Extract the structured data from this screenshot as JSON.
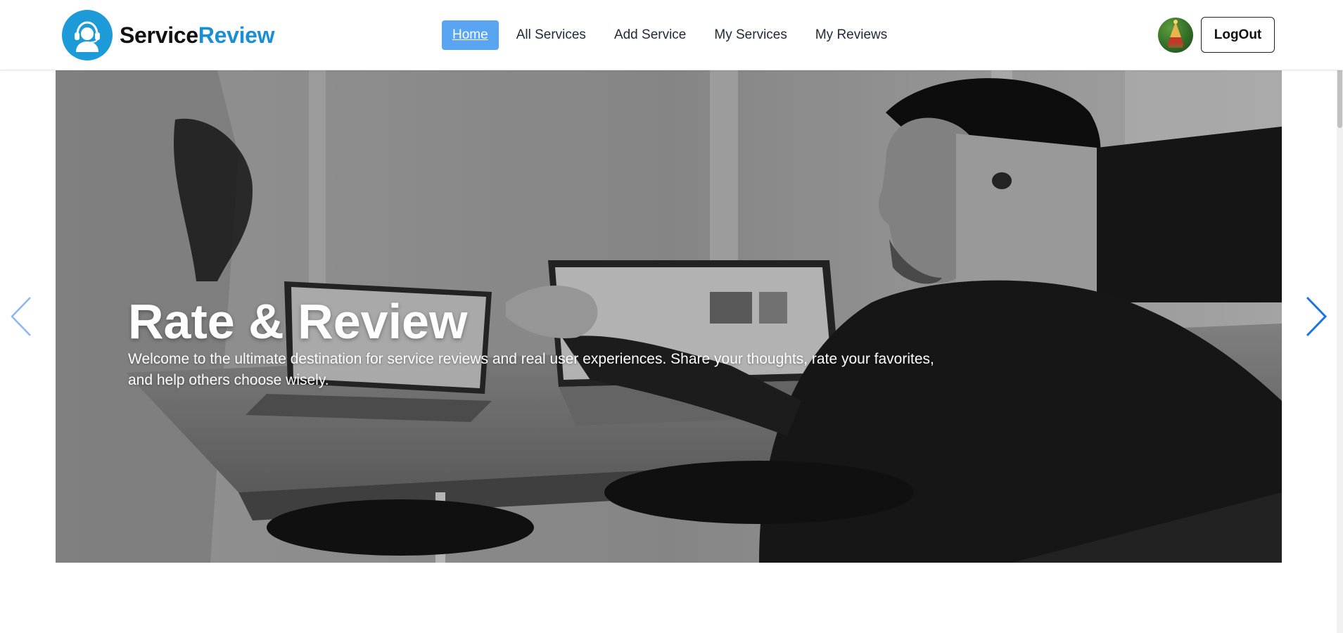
{
  "brand": {
    "name_part1": "Service",
    "name_part2": "Review",
    "logo_icon": "support-agent-icon",
    "accent_color": "#1b8fd2"
  },
  "nav": {
    "items": [
      {
        "label": "Home",
        "active": true
      },
      {
        "label": "All Services",
        "active": false
      },
      {
        "label": "Add Service",
        "active": false
      },
      {
        "label": "My Services",
        "active": false
      },
      {
        "label": "My Reviews",
        "active": false
      }
    ],
    "active_color": "#5aa5f2"
  },
  "user": {
    "avatar_icon": "user-avatar",
    "logout_label": "LogOut"
  },
  "slider": {
    "slides": [
      {
        "title": "Rate & Review",
        "text": "Welcome to the ultimate destination for service reviews and real user experiences. Share your thoughts, rate your favorites, and help others choose wisely."
      }
    ],
    "prev_icon": "chevron-left-icon",
    "next_icon": "chevron-right-icon",
    "arrow_color": "#1a73e8"
  }
}
